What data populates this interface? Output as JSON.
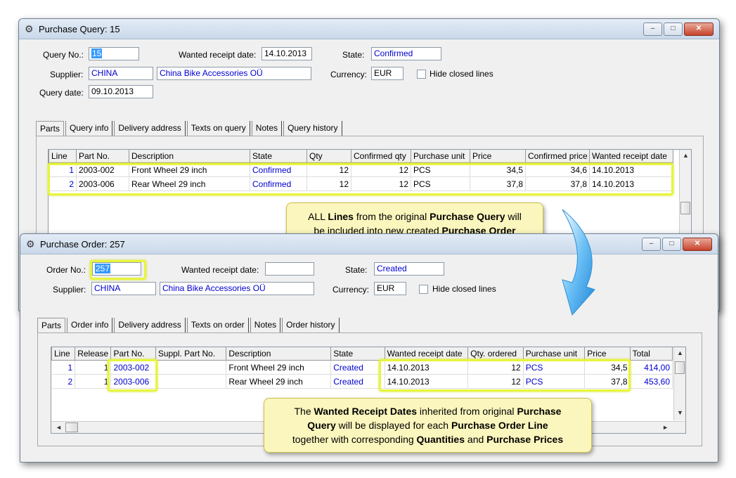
{
  "query": {
    "title": "Purchase Query: 15",
    "query_no_label": "Query No.:",
    "query_no": "15",
    "wanted_label": "Wanted receipt date:",
    "wanted_date": "14.10.2013",
    "state_label": "State:",
    "state": "Confirmed",
    "supplier_label": "Supplier:",
    "supplier_code": "CHINA",
    "supplier_name": "China Bike Accessories OÜ",
    "currency_label": "Currency:",
    "currency": "EUR",
    "hide_closed": "Hide closed lines",
    "date_label": "Query date:",
    "query_date": "09.10.2013",
    "tabs": [
      "Parts",
      "Query info",
      "Delivery address",
      "Texts on query",
      "Notes",
      "Query history"
    ],
    "columns": [
      "Line",
      "Part No.",
      "Description",
      "State",
      "Qty",
      "Confirmed qty",
      "Purchase unit",
      "Price",
      "Confirmed price",
      "Wanted receipt date"
    ],
    "rows": [
      [
        "1",
        "2003-002",
        "Front Wheel 29 inch",
        "Confirmed",
        "12",
        "12",
        "PCS",
        "34,5",
        "34,6",
        "14.10.2013"
      ],
      [
        "2",
        "2003-006",
        "Rear Wheel 29 inch",
        "Confirmed",
        "12",
        "12",
        "PCS",
        "37,8",
        "37,8",
        "14.10.2013"
      ]
    ]
  },
  "order": {
    "title": "Purchase Order: 257",
    "order_no_label": "Order No.:",
    "order_no": "257",
    "wanted_label": "Wanted receipt date:",
    "wanted_date": "",
    "state_label": "State:",
    "state": "Created",
    "supplier_label": "Supplier:",
    "supplier_code": "CHINA",
    "supplier_name": "China Bike Accessories OÜ",
    "currency_label": "Currency:",
    "currency": "EUR",
    "hide_closed": "Hide closed lines",
    "tabs": [
      "Parts",
      "Order info",
      "Delivery address",
      "Texts on order",
      "Notes",
      "Order history"
    ],
    "columns": [
      "Line",
      "Release",
      "Part No.",
      "Suppl. Part No.",
      "Description",
      "State",
      "Wanted receipt date",
      "Qty. ordered",
      "Purchase unit",
      "Price",
      "Total"
    ],
    "rows": [
      [
        "1",
        "1",
        "2003-002",
        "",
        "Front Wheel 29 inch",
        "Created",
        "14.10.2013",
        "12",
        "PCS",
        "34,5",
        "414,00"
      ],
      [
        "2",
        "1",
        "2003-006",
        "",
        "Rear Wheel 29 inch",
        "Created",
        "14.10.2013",
        "12",
        "PCS",
        "37,8",
        "453,60"
      ]
    ]
  },
  "callout1": {
    "p1": "ALL ",
    "b1": "Lines",
    "p2": " from the original ",
    "b2": "Purchase Query",
    "p3": " will",
    "p4": "be included into new created ",
    "b3": "Purchase Order"
  },
  "callout2": {
    "p1": "The ",
    "b1": "Wanted Receipt Dates",
    "p2": " inherited from original ",
    "b2": "Purchase",
    "b3": "Query",
    "p3": " will be displayed for each ",
    "b4": "Purchase Order Line",
    "p4": "together with corresponding ",
    "b5": "Quantities",
    "p5": " and ",
    "b6": "Purchase Prices"
  },
  "colors": {
    "highlight": "#e8f53c",
    "callout_bg": "#fbf6bd",
    "arrow": "#3aa0e8",
    "link_blue": "#0000d0"
  }
}
